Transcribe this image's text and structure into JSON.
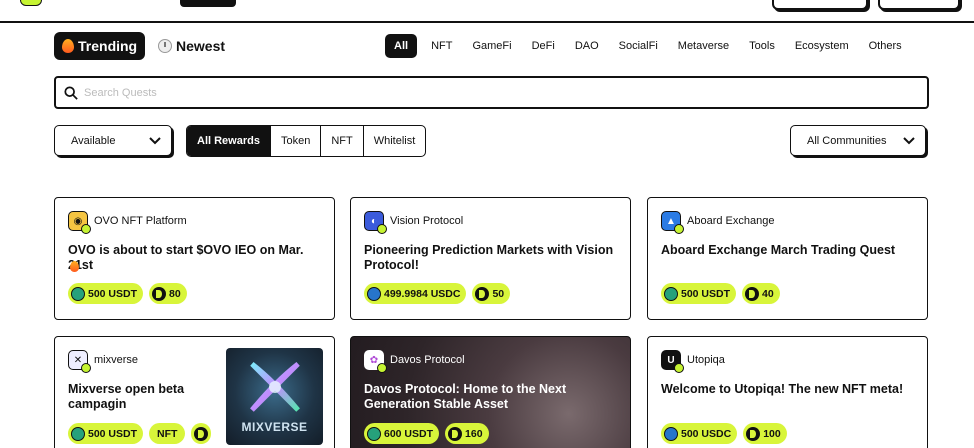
{
  "sort_tabs": {
    "trending": "Trending",
    "newest": "Newest"
  },
  "categories": [
    "All",
    "NFT",
    "GameFi",
    "DeFi",
    "DAO",
    "SocialFi",
    "Metaverse",
    "Tools",
    "Ecosystem",
    "Others"
  ],
  "search": {
    "placeholder": "Search Quests",
    "value": ""
  },
  "filters": {
    "availability": "Available",
    "rewards": [
      "All Rewards",
      "Token",
      "NFT",
      "Whitelist"
    ],
    "communities": "All Communities"
  },
  "cards": [
    {
      "community": "OVO NFT Platform",
      "title": "OVO is about to start $OVO IEO on Mar. 21st",
      "rewards": [
        "500 USDT",
        "80"
      ]
    },
    {
      "community": "Vision Protocol",
      "title": "Pioneering Prediction Markets with Vision Protocol!",
      "rewards": [
        "499.9984 USDC",
        "50"
      ]
    },
    {
      "community": "Aboard Exchange",
      "title": "Aboard Exchange March Trading Quest",
      "rewards": [
        "500 USDT",
        "40"
      ]
    },
    {
      "community": "mixverse",
      "title": "Mixverse open beta campagin",
      "rewards": [
        "500 USDT",
        "NFT"
      ],
      "thumb_text": "MIXVERSE"
    },
    {
      "community": "Davos Protocol",
      "title": "Davos Protocol: Home to the Next Generation Stable Asset",
      "rewards": [
        "600 USDT",
        "160"
      ]
    },
    {
      "community": "Utopiqa",
      "title": "Welcome to Utopiqa! The new NFT meta!",
      "rewards": [
        "500 USDC",
        "100"
      ]
    }
  ],
  "colors": {
    "accent": "#d8f53a",
    "dark": "#111111"
  }
}
